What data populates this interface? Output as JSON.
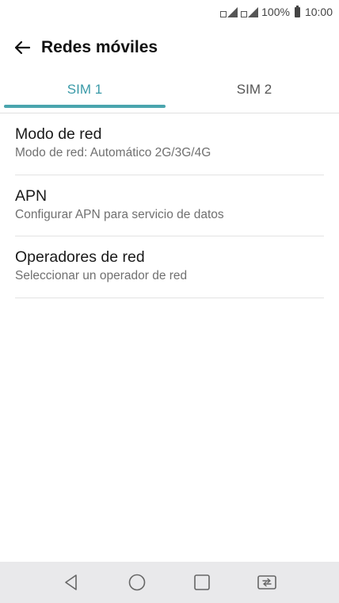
{
  "status_bar": {
    "battery_percent": "100%",
    "time": "10:00",
    "icons": [
      "sim1-signal-icon",
      "sim2-signal-icon",
      "battery-icon"
    ]
  },
  "app_bar": {
    "title": "Redes móviles",
    "back_icon": "arrow-left-icon"
  },
  "tabs": [
    {
      "label": "SIM 1",
      "active": true
    },
    {
      "label": "SIM 2",
      "active": false
    }
  ],
  "items": [
    {
      "title": "Modo de red",
      "subtitle": "Modo de red: Automático 2G/3G/4G"
    },
    {
      "title": "APN",
      "subtitle": "Configurar APN para servicio de datos"
    },
    {
      "title": "Operadores de red",
      "subtitle": "Seleccionar un operador de red"
    }
  ],
  "nav_bar": {
    "icons": [
      "back-triangle-icon",
      "home-circle-icon",
      "recents-square-icon",
      "dual-window-icon"
    ]
  },
  "colors": {
    "accent": "#3a9aa8",
    "nav_background": "#e9e9eb"
  }
}
